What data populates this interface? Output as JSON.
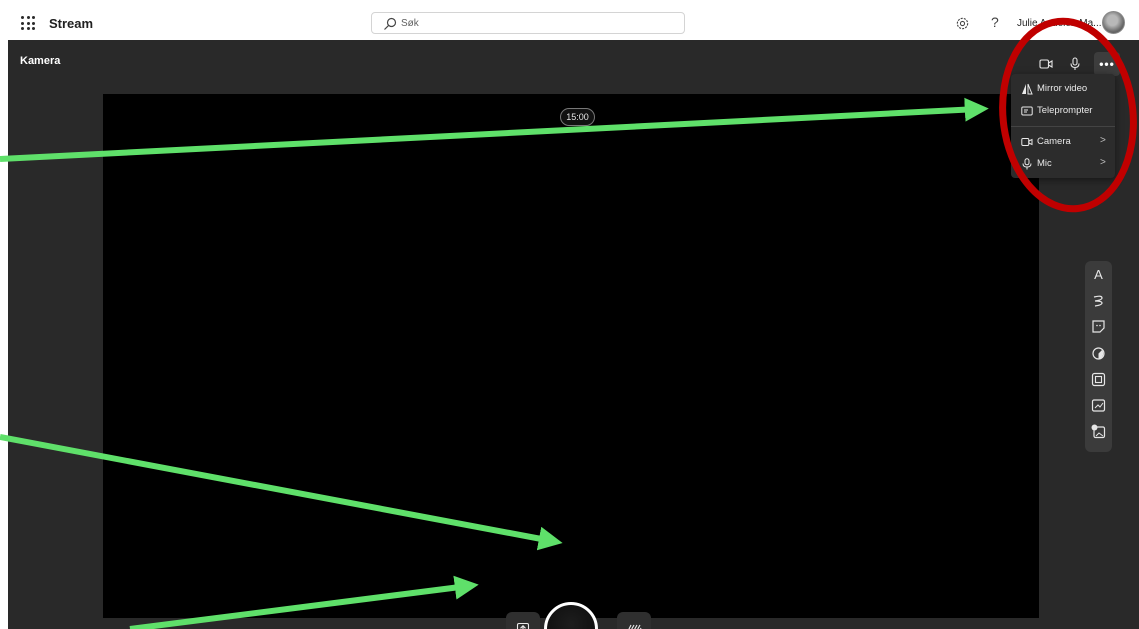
{
  "header": {
    "app_name": "Stream",
    "search_placeholder": "Søk",
    "help_label": "?",
    "user_name": "Julie Andelen Ma..."
  },
  "recorder": {
    "title": "Kamera",
    "timer": "15:00",
    "more_label": "•••",
    "menu": {
      "mirror_label": "Mirror video",
      "teleprompter_label": "Teleprompter",
      "camera_label": "Camera",
      "mic_label": "Mic",
      "chevron": ">"
    },
    "tools": {
      "text_label": "A"
    }
  },
  "icons": {
    "waffle": "app-launcher-icon",
    "search": "search-icon",
    "settings": "gear-icon",
    "camera": "video-camera-icon",
    "mic": "microphone-icon",
    "upload": "upload-icon",
    "effects": "background-effects-icon",
    "mirror": "mirror-icon",
    "teleprompter": "teleprompter-icon"
  },
  "colors": {
    "annotation_arrow": "#5fe06a",
    "annotation_circle": "#c00000",
    "recorder_bg": "#292929",
    "preview_bg": "#000000"
  }
}
